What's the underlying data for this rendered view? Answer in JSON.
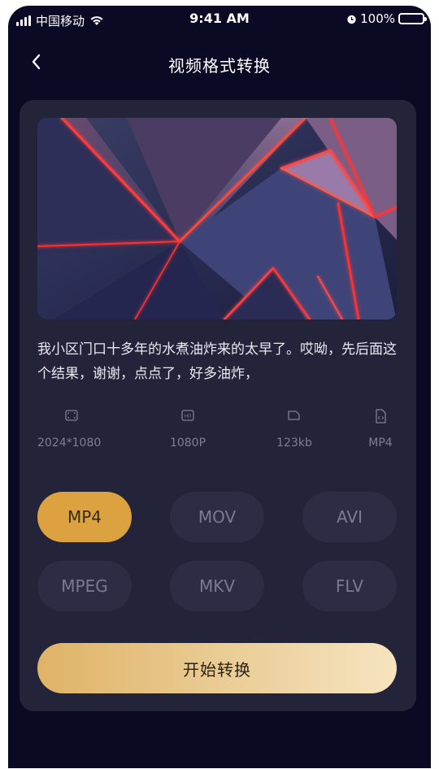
{
  "status": {
    "carrier": "中国移动",
    "time": "9:41 AM",
    "battery": "100%"
  },
  "nav": {
    "title": "视频格式转换"
  },
  "video": {
    "description": "我小区门口十多年的水煮油炸来的太早了。哎呦，先后面这个结果，谢谢，点点了，好多油炸，",
    "meta": [
      {
        "icon": "resolution-icon",
        "value": "2024*1080"
      },
      {
        "icon": "hd-icon",
        "value": "1080P"
      },
      {
        "icon": "file-size-icon",
        "value": "123kb"
      },
      {
        "icon": "code-file-icon",
        "value": "MP4"
      }
    ]
  },
  "formats": {
    "options": [
      "MP4",
      "MOV",
      "AVI",
      "MPEG",
      "MKV",
      "FLV"
    ],
    "selected": "MP4"
  },
  "colors": {
    "background": "#0b0a25",
    "card": "#23233a",
    "accent": "#dba23f"
  },
  "actions": {
    "start_label": "开始转换"
  }
}
